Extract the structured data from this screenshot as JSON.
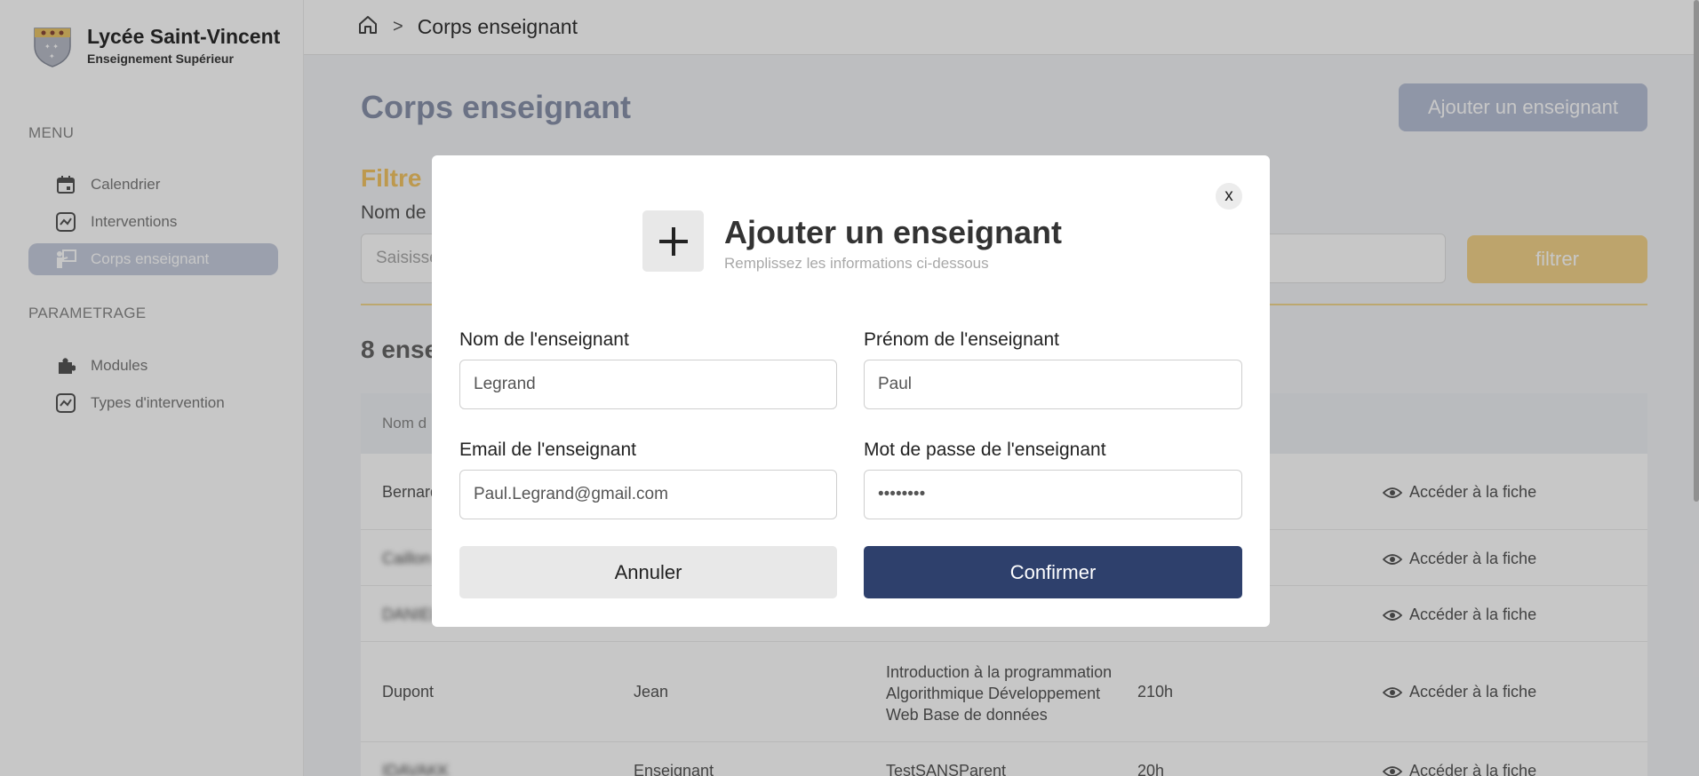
{
  "sidebar": {
    "brand_title": "Lycée Saint-Vincent",
    "brand_subtitle": "Enseignement Supérieur",
    "menu_heading": "MENU",
    "menu_items": [
      {
        "label": "Calendrier",
        "icon": "calendar-icon"
      },
      {
        "label": "Interventions",
        "icon": "chart-icon"
      },
      {
        "label": "Corps enseignant",
        "icon": "teacher-icon",
        "active": true
      }
    ],
    "settings_heading": "PARAMETRAGE",
    "settings_items": [
      {
        "label": "Modules",
        "icon": "puzzle-icon"
      },
      {
        "label": "Types d'intervention",
        "icon": "chart-icon"
      }
    ]
  },
  "breadcrumb": {
    "separator": ">",
    "current": "Corps enseignant"
  },
  "main": {
    "title": "Corps enseignant",
    "add_button": "Ajouter un enseignant",
    "filter_title": "Filtre",
    "filter_label": "Nom de",
    "filter_placeholder": "Saisisse",
    "filter_button": "filtrer",
    "count_title": "8 ense",
    "table_header_first": "Nom d",
    "rows": [
      {
        "name": "Bernard",
        "firstname": "",
        "modules": "",
        "hours": "",
        "action": "Accéder à la fiche"
      },
      {
        "name": "Caillon",
        "firstname": "",
        "modules": "",
        "hours": "",
        "action": "Accéder à la fiche"
      },
      {
        "name": "DANIEL",
        "firstname": "",
        "modules": "",
        "hours": "",
        "action": "Accéder à la fiche"
      },
      {
        "name": "Dupont",
        "firstname": "Jean",
        "modules": "Introduction à la programmation Algorithmique Développement Web Base de données",
        "hours": "210h",
        "action": "Accéder à la fiche"
      },
      {
        "name": "IDAVAKK",
        "firstname": "Enseignant",
        "modules": "TestSANSParent",
        "hours": "20h",
        "action": "Accéder à la fiche"
      }
    ]
  },
  "modal": {
    "close_label": "x",
    "title": "Ajouter un enseignant",
    "subtitle": "Remplissez les informations ci-dessous",
    "lastname_label": "Nom de l'enseignant",
    "lastname_value": "Legrand",
    "firstname_label": "Prénom de l'enseignant",
    "firstname_value": "Paul",
    "email_label": "Email de l'enseignant",
    "email_value": "Paul.Legrand@gmail.com",
    "password_label": "Mot de passe de l'enseignant",
    "password_value": "••••••••",
    "cancel_label": "Annuler",
    "confirm_label": "Confirmer"
  },
  "colors": {
    "accent_yellow": "#f2c464",
    "confirm_blue": "#2e406c",
    "active_menu": "#c7cdde"
  }
}
